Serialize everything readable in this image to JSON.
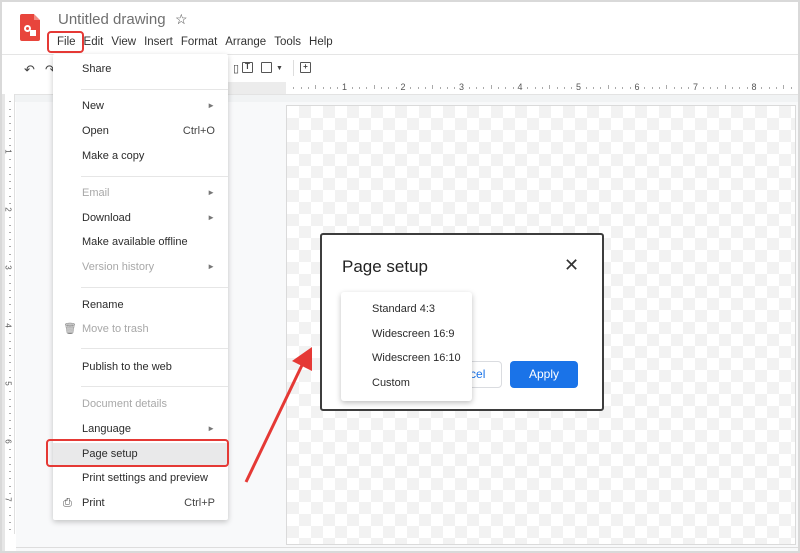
{
  "app": {
    "title": "Untitled drawing",
    "star_icon": "star-outline-icon",
    "logo_icon": "google-drawings-logo"
  },
  "menubar": {
    "items": [
      "File",
      "Edit",
      "View",
      "Insert",
      "Format",
      "Arrange",
      "Tools",
      "Help"
    ]
  },
  "toolbar": {
    "undo_icon": "undo-icon",
    "redo_icon": "redo-icon",
    "textbox_icon": "text-box-icon",
    "image_icon": "image-icon",
    "comment_icon": "add-comment-icon"
  },
  "ruler": {
    "horizontal": [
      "1",
      "2",
      "3",
      "4",
      "5",
      "6",
      "7",
      "8"
    ],
    "vertical": [
      "1",
      "2",
      "3",
      "4",
      "5",
      "6",
      "7"
    ]
  },
  "file_menu": {
    "share": "Share",
    "new": "New",
    "open": "Open",
    "open_shortcut": "Ctrl+O",
    "make_copy": "Make a copy",
    "email": "Email",
    "download": "Download",
    "make_offline": "Make available offline",
    "version_history": "Version history",
    "rename": "Rename",
    "move_trash": "Move to trash",
    "publish": "Publish to the web",
    "document_details": "Document details",
    "language": "Language",
    "page_setup": "Page setup",
    "print_settings": "Print settings and preview",
    "print": "Print",
    "print_shortcut": "Ctrl+P",
    "submenu_arrow": "►"
  },
  "dialog": {
    "title": "Page setup",
    "close": "✕",
    "cancel_label": "Cancel",
    "apply_label": "Apply",
    "options": [
      "Standard 4:3",
      "Widescreen 16:9",
      "Widescreen 16:10",
      "Custom"
    ]
  },
  "annotations": {
    "highlight_color": "#e53935",
    "accent_color": "#1a73e8"
  }
}
